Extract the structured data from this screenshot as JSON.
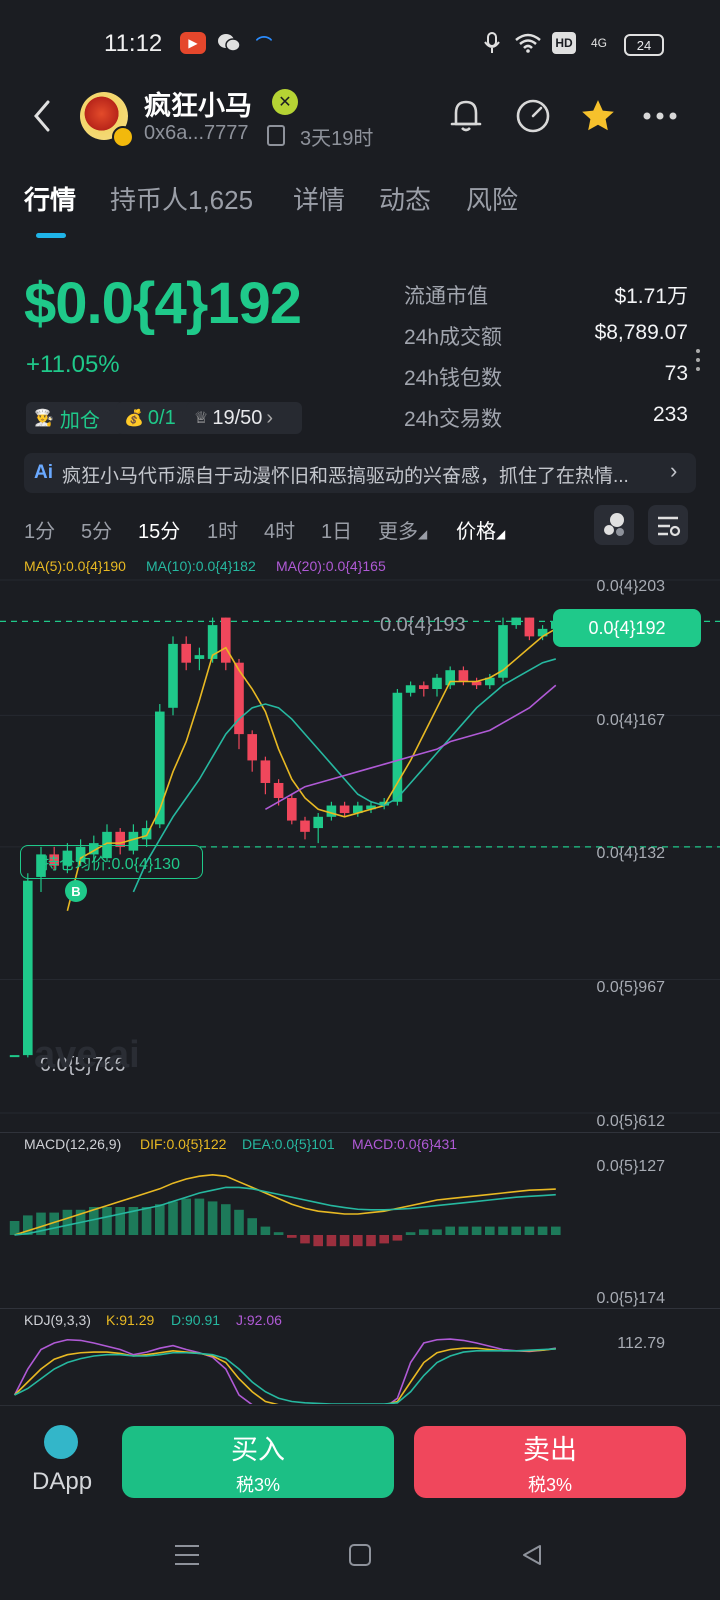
{
  "status": {
    "time": "11:12",
    "hd": "HD",
    "net": "4G",
    "battery": "24"
  },
  "header": {
    "title": "疯狂小马",
    "verify_mark": "✕",
    "address": "0x6a...7777",
    "age": "3天19时"
  },
  "tabs": [
    "行情",
    "持币人1,625",
    "详情",
    "动态",
    "风险"
  ],
  "price": {
    "value": "$0.0{4}192",
    "change": "+11.05%"
  },
  "chips": {
    "add": "加仓",
    "bag": "0/1",
    "rank": "19/50"
  },
  "stats": [
    {
      "label": "流通市值",
      "value": "$1.71万"
    },
    {
      "label": "24h成交额",
      "value": "$8,789.07"
    },
    {
      "label": "24h钱包数",
      "value": "73"
    },
    {
      "label": "24h交易数",
      "value": "233"
    }
  ],
  "ai": {
    "badge": "Ai",
    "text": "疯狂小马代币源自于动漫怀旧和恶搞驱动的兴奋感，抓住了在热情..."
  },
  "timeframes": [
    "1分",
    "5分",
    "15分",
    "1时",
    "4时",
    "1日",
    "更多",
    "价格"
  ],
  "active_timeframe": "15分",
  "ma_legend": {
    "ma5": "MA(5):0.0{4}190",
    "ma10": "MA(10):0.0{4}182",
    "ma20": "MA(20):0.0{4}165"
  },
  "axis_labels": [
    "0.0{4}203",
    "0.0{4}167",
    "0.0{4}132",
    "0.0{5}967",
    "0.0{5}612"
  ],
  "current_price_tag": "0.0{4}192",
  "high_label": "0.0{4}193",
  "low_label": "0.0{5}766",
  "hold_label": "持仓均价:0.0{4}130",
  "buy_marker": "B",
  "watermark": "ave.ai",
  "macd_legend": {
    "title": "MACD(12,26,9)",
    "dif": "DIF:0.0{5}122",
    "dea": "DEA:0.0{5}101",
    "macd": "MACD:0.0{6}431"
  },
  "macd_axis": [
    "0.0{5}127",
    "0.0{5}174"
  ],
  "kdj_legend": {
    "title": "KDJ(9,3,3)",
    "k": "K:91.29",
    "d": "D:90.91",
    "j": "J:92.06"
  },
  "kdj_axis": "112.79",
  "bottom": {
    "dapp": "DApp",
    "buy": "买入",
    "buy_tax": "税3%",
    "sell": "卖出",
    "sell_tax": "税3%"
  },
  "colors": {
    "up": "#1fc98a",
    "down": "#f0475c",
    "ma5": "#e8b923",
    "ma10": "#26b8a0",
    "ma20": "#b05ad6"
  },
  "chart_data": {
    "type": "candlestick",
    "candles": [
      [
        7.66e-06,
        7.66e-06,
        7e-06,
        7e-06
      ],
      [
        7.66e-06,
        1.23e-05,
        1.25e-05,
        7.6e-06
      ],
      [
        1.24e-05,
        1.3e-05,
        1.32e-05,
        1.2e-05
      ],
      [
        1.3e-05,
        1.27e-05,
        1.32e-05,
        1.26e-05
      ],
      [
        1.27e-05,
        1.31e-05,
        1.33e-05,
        1.25e-05
      ],
      [
        1.28e-05,
        1.32e-05,
        1.34e-05,
        1.27e-05
      ],
      [
        1.3e-05,
        1.33e-05,
        1.35e-05,
        1.28e-05
      ],
      [
        1.29e-05,
        1.36e-05,
        1.38e-05,
        1.28e-05
      ],
      [
        1.36e-05,
        1.32e-05,
        1.37e-05,
        1.3e-05
      ],
      [
        1.31e-05,
        1.36e-05,
        1.38e-05,
        1.3e-05
      ],
      [
        1.34e-05,
        1.37e-05,
        1.39e-05,
        1.32e-05
      ],
      [
        1.38e-05,
        1.68e-05,
        1.7e-05,
        1.37e-05
      ],
      [
        1.69e-05,
        1.86e-05,
        1.88e-05,
        1.67e-05
      ],
      [
        1.86e-05,
        1.81e-05,
        1.88e-05,
        1.79e-05
      ],
      [
        1.82e-05,
        1.83e-05,
        1.85e-05,
        1.79e-05
      ],
      [
        1.82e-05,
        1.91e-05,
        1.93e-05,
        1.81e-05
      ],
      [
        1.93e-05,
        1.81e-05,
        1.93e-05,
        1.79e-05
      ],
      [
        1.81e-05,
        1.62e-05,
        1.82e-05,
        1.58e-05
      ],
      [
        1.62e-05,
        1.55e-05,
        1.63e-05,
        1.52e-05
      ],
      [
        1.55e-05,
        1.49e-05,
        1.56e-05,
        1.46e-05
      ],
      [
        1.49e-05,
        1.45e-05,
        1.5e-05,
        1.43e-05
      ],
      [
        1.45e-05,
        1.39e-05,
        1.46e-05,
        1.38e-05
      ],
      [
        1.39e-05,
        1.36e-05,
        1.4e-05,
        1.34e-05
      ],
      [
        1.37e-05,
        1.4e-05,
        1.41e-05,
        1.33e-05
      ],
      [
        1.4e-05,
        1.43e-05,
        1.44e-05,
        1.39e-05
      ],
      [
        1.43e-05,
        1.41e-05,
        1.44e-05,
        1.4e-05
      ],
      [
        1.41e-05,
        1.43e-05,
        1.44e-05,
        1.4e-05
      ],
      [
        1.42e-05,
        1.43e-05,
        1.44e-05,
        1.41e-05
      ],
      [
        1.43e-05,
        1.44e-05,
        1.45e-05,
        1.42e-05
      ],
      [
        1.44e-05,
        1.73e-05,
        1.74e-05,
        1.43e-05
      ],
      [
        1.73e-05,
        1.75e-05,
        1.76e-05,
        1.72e-05
      ],
      [
        1.75e-05,
        1.74e-05,
        1.76e-05,
        1.72e-05
      ],
      [
        1.74e-05,
        1.77e-05,
        1.78e-05,
        1.72e-05
      ],
      [
        1.75e-05,
        1.79e-05,
        1.8e-05,
        1.74e-05
      ],
      [
        1.79e-05,
        1.76e-05,
        1.8e-05,
        1.75e-05
      ],
      [
        1.76e-05,
        1.75e-05,
        1.77e-05,
        1.74e-05
      ],
      [
        1.75e-05,
        1.77e-05,
        1.78e-05,
        1.74e-05
      ],
      [
        1.77e-05,
        1.91e-05,
        1.93e-05,
        1.76e-05
      ],
      [
        1.91e-05,
        1.93e-05,
        1.93e-05,
        1.9e-05
      ],
      [
        1.93e-05,
        1.88e-05,
        1.93e-05,
        1.87e-05
      ],
      [
        1.88e-05,
        1.9e-05,
        1.91e-05,
        1.87e-05
      ],
      [
        1.9e-05,
        1.92e-05,
        1.93e-05,
        1.89e-05
      ]
    ],
    "ma5": [
      null,
      null,
      null,
      null,
      1.15e-05,
      1.29e-05,
      1.31e-05,
      1.33e-05,
      1.33e-05,
      1.34e-05,
      1.35e-05,
      1.42e-05,
      1.52e-05,
      1.6e-05,
      1.71e-05,
      1.83e-05,
      1.85e-05,
      1.79e-05,
      1.74e-05,
      1.68e-05,
      1.58e-05,
      1.5e-05,
      1.45e-05,
      1.42e-05,
      1.41e-05,
      1.4e-05,
      1.41e-05,
      1.42e-05,
      1.43e-05,
      1.49e-05,
      1.55e-05,
      1.62e-05,
      1.69e-05,
      1.76e-05,
      1.76e-05,
      1.76e-05,
      1.77e-05,
      1.79e-05,
      1.82e-05,
      1.85e-05,
      1.88e-05,
      1.9e-05
    ],
    "ma10": [
      null,
      null,
      null,
      null,
      null,
      null,
      null,
      null,
      null,
      1.2e-05,
      1.28e-05,
      1.34e-05,
      1.4e-05,
      1.45e-05,
      1.5e-05,
      1.56e-05,
      1.62e-05,
      1.66e-05,
      1.69e-05,
      1.7e-05,
      1.69e-05,
      1.66e-05,
      1.62e-05,
      1.58e-05,
      1.54e-05,
      1.5e-05,
      1.46e-05,
      1.44e-05,
      1.43e-05,
      1.45e-05,
      1.49e-05,
      1.53e-05,
      1.57e-05,
      1.61e-05,
      1.65e-05,
      1.69e-05,
      1.72e-05,
      1.75e-05,
      1.77e-05,
      1.79e-05,
      1.81e-05,
      1.82e-05
    ],
    "ma20": [
      null,
      null,
      null,
      null,
      null,
      null,
      null,
      null,
      null,
      null,
      null,
      null,
      null,
      null,
      null,
      null,
      null,
      null,
      null,
      1.42e-05,
      1.44e-05,
      1.46e-05,
      1.48e-05,
      1.49e-05,
      1.5e-05,
      1.51e-05,
      1.52e-05,
      1.53e-05,
      1.54e-05,
      1.55e-05,
      1.56e-05,
      1.57e-05,
      1.58e-05,
      1.6e-05,
      1.61e-05,
      1.62e-05,
      1.63e-05,
      1.65e-05,
      1.67e-05,
      1.69e-05,
      1.72e-05,
      1.75e-05
    ],
    "price_range": [
      6.12e-06,
      2.03e-05
    ],
    "macd_hist": [
      0.5,
      0.7,
      0.8,
      0.8,
      0.9,
      0.9,
      1.0,
      1.0,
      1.0,
      1.0,
      1.0,
      1.1,
      1.2,
      1.3,
      1.3,
      1.2,
      1.1,
      0.9,
      0.6,
      0.3,
      0.1,
      -0.1,
      -0.3,
      -0.4,
      -0.4,
      -0.4,
      -0.4,
      -0.4,
      -0.3,
      -0.2,
      0.1,
      0.2,
      0.2,
      0.3,
      0.3,
      0.3,
      0.3,
      0.3,
      0.3,
      0.3,
      0.3,
      0.3
    ],
    "dif": [
      0.0,
      0.15,
      0.3,
      0.45,
      0.6,
      0.75,
      0.9,
      1.05,
      1.2,
      1.35,
      1.5,
      1.65,
      1.85,
      2.0,
      2.1,
      2.15,
      2.1,
      1.9,
      1.7,
      1.5,
      1.3,
      1.1,
      0.95,
      0.85,
      0.8,
      0.75,
      0.75,
      0.8,
      0.85,
      0.95,
      1.05,
      1.15,
      1.25,
      1.3,
      1.35,
      1.4,
      1.45,
      1.5,
      1.55,
      1.6,
      1.62,
      1.64
    ],
    "dea": [
      0.0,
      0.05,
      0.15,
      0.25,
      0.35,
      0.45,
      0.55,
      0.65,
      0.75,
      0.85,
      0.95,
      1.05,
      1.2,
      1.35,
      1.5,
      1.6,
      1.7,
      1.7,
      1.65,
      1.55,
      1.45,
      1.35,
      1.25,
      1.15,
      1.05,
      0.98,
      0.92,
      0.9,
      0.9,
      0.92,
      0.95,
      1.0,
      1.05,
      1.1,
      1.15,
      1.2,
      1.25,
      1.3,
      1.35,
      1.38,
      1.41,
      1.44
    ],
    "kdj_k": [
      20,
      40,
      60,
      75,
      82,
      85,
      86,
      86,
      84,
      80,
      82,
      85,
      88,
      86,
      84,
      80,
      70,
      45,
      25,
      10,
      5,
      5,
      5,
      5,
      5,
      5,
      5,
      5,
      5,
      10,
      40,
      70,
      85,
      90,
      92,
      92,
      90,
      88,
      88,
      88,
      89,
      91.29
    ],
    "kdj_d": [
      20,
      30,
      45,
      60,
      70,
      76,
      80,
      82,
      82,
      80,
      80,
      82,
      85,
      85,
      84,
      82,
      76,
      60,
      40,
      25,
      15,
      10,
      8,
      7,
      6,
      6,
      6,
      6,
      6,
      8,
      25,
      50,
      70,
      80,
      86,
      88,
      88,
      88,
      88,
      89,
      90,
      90.91
    ],
    "kdj_j": [
      20,
      60,
      90,
      100,
      105,
      104,
      100,
      95,
      90,
      82,
      86,
      92,
      96,
      90,
      85,
      78,
      60,
      20,
      5,
      0,
      0,
      0,
      0,
      0,
      0,
      0,
      0,
      0,
      0,
      15,
      70,
      100,
      105,
      106,
      104,
      100,
      95,
      90,
      88,
      87,
      89,
      92.06
    ]
  }
}
